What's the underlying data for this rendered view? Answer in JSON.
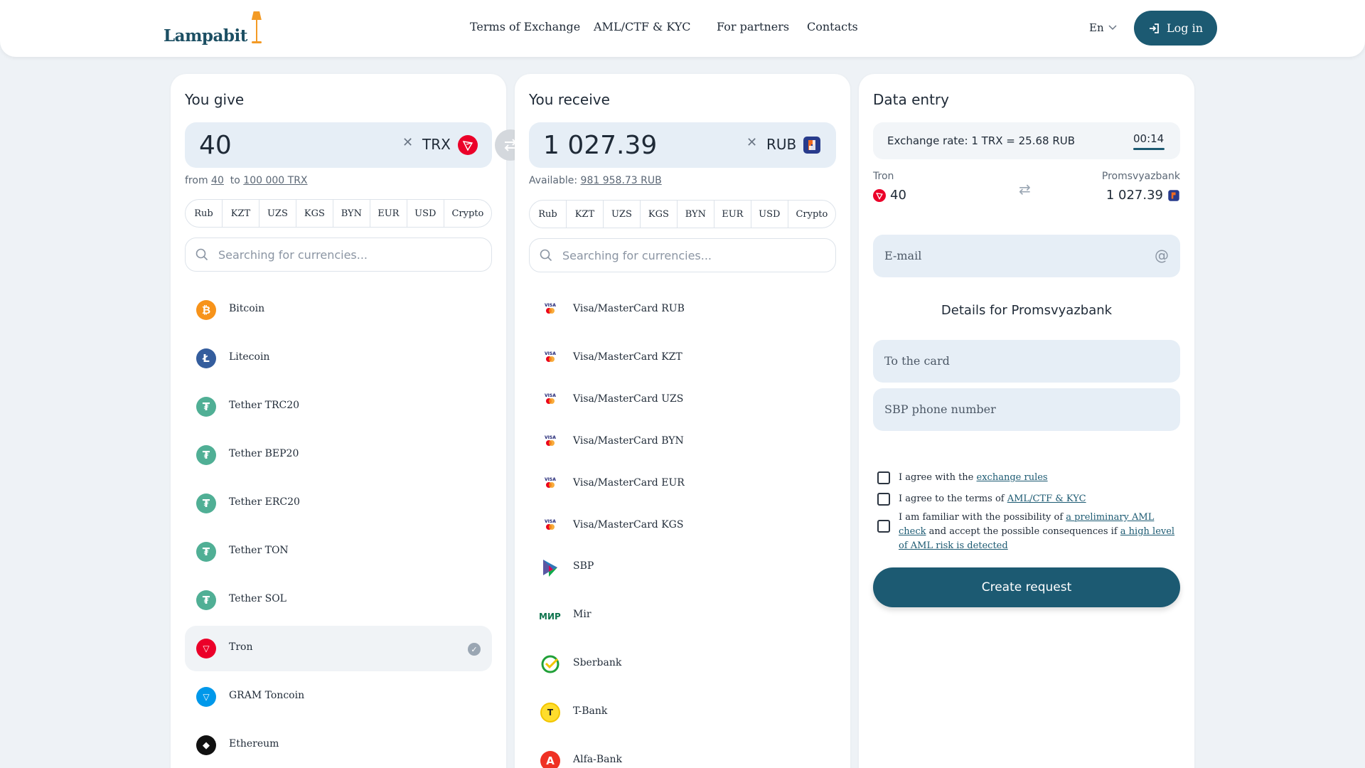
{
  "header": {
    "logo": "Lampabit",
    "nav": [
      "Terms of Exchange",
      "AML/CTF & KYC",
      "For partners",
      "Contacts"
    ],
    "lang": "En",
    "login": "Log in"
  },
  "give": {
    "title": "You give",
    "amount": "40",
    "currency": "TRX",
    "from_label": "from",
    "from_value": "40",
    "to_label": "to",
    "to_value": "100 000 TRX",
    "tabs": [
      "Rub",
      "KZT",
      "UZS",
      "KGS",
      "BYN",
      "EUR",
      "USD",
      "Crypto"
    ],
    "search_placeholder": "Searching for currencies...",
    "items": [
      {
        "label": "Bitcoin",
        "icon": "bitcoin-icon",
        "color": "#f7931a",
        "glyph": "₿"
      },
      {
        "label": "Litecoin",
        "icon": "litecoin-icon",
        "color": "#345d9d",
        "glyph": "Ł"
      },
      {
        "label": "Tether TRC20",
        "icon": "tether-icon",
        "color": "#50af95",
        "glyph": "₮"
      },
      {
        "label": "Tether BEP20",
        "icon": "tether-icon",
        "color": "#50af95",
        "glyph": "₮"
      },
      {
        "label": "Tether ERC20",
        "icon": "tether-icon",
        "color": "#50af95",
        "glyph": "₮"
      },
      {
        "label": "Tether TON",
        "icon": "tether-icon",
        "color": "#50af95",
        "glyph": "₮"
      },
      {
        "label": "Tether SOL",
        "icon": "tether-icon",
        "color": "#50af95",
        "glyph": "₮"
      },
      {
        "label": "Tron",
        "icon": "tron-icon",
        "color": "#eb0029",
        "glyph": "▽"
      },
      {
        "label": "GRAM Toncoin",
        "icon": "toncoin-icon",
        "color": "#0098ea",
        "glyph": "▽"
      },
      {
        "label": "Ethereum",
        "icon": "ethereum-icon",
        "color": "#111111",
        "glyph": "◆"
      }
    ]
  },
  "receive": {
    "title": "You receive",
    "amount": "1 027.39",
    "currency": "RUB",
    "available_label": "Available:",
    "available_value": "981 958.73 RUB",
    "tabs": [
      "Rub",
      "KZT",
      "UZS",
      "KGS",
      "BYN",
      "EUR",
      "USD",
      "Crypto"
    ],
    "search_placeholder": "Searching for currencies...",
    "items": [
      {
        "label": "Visa/MasterCard RUB",
        "icon": "visa-mastercard-icon"
      },
      {
        "label": "Visa/MasterCard KZT",
        "icon": "visa-mastercard-icon"
      },
      {
        "label": "Visa/MasterCard UZS",
        "icon": "visa-mastercard-icon"
      },
      {
        "label": "Visa/MasterCard BYN",
        "icon": "visa-mastercard-icon"
      },
      {
        "label": "Visa/MasterCard EUR",
        "icon": "visa-mastercard-icon"
      },
      {
        "label": "Visa/MasterCard KGS",
        "icon": "visa-mastercard-icon"
      },
      {
        "label": "SBP",
        "icon": "sbp-icon"
      },
      {
        "label": "Mir",
        "icon": "mir-icon"
      },
      {
        "label": "Sberbank",
        "icon": "sberbank-icon"
      },
      {
        "label": "T-Bank",
        "icon": "tbank-icon"
      },
      {
        "label": "Alfa-Bank",
        "icon": "alfabank-icon"
      }
    ]
  },
  "data_entry": {
    "title": "Data entry",
    "rate": "Exchange rate: 1 TRX = 25.68 RUB",
    "timer": "00:14",
    "left_name": "Tron",
    "left_value": "40",
    "right_name": "Promsvyazbank",
    "right_value": "1 027.39",
    "email_label": "E-mail",
    "details_title": "Details for Promsvyazbank",
    "card_label": "To the card",
    "phone_label": "SBP phone number",
    "agree1_text": "I agree with the",
    "agree1_link": "exchange rules",
    "agree2_text": "I agree to the terms of",
    "agree2_link": "AML/CTF & KYC",
    "agree3_text1": "I am familiar with the possibility of",
    "agree3_link1": "a preliminary AML check",
    "agree3_text2": "and accept the possible consequences if",
    "agree3_link2": "a high level of AML risk is detected",
    "create": "Create request"
  },
  "colors": {
    "brand": "#1c5a72",
    "accent": "#f39a25"
  }
}
